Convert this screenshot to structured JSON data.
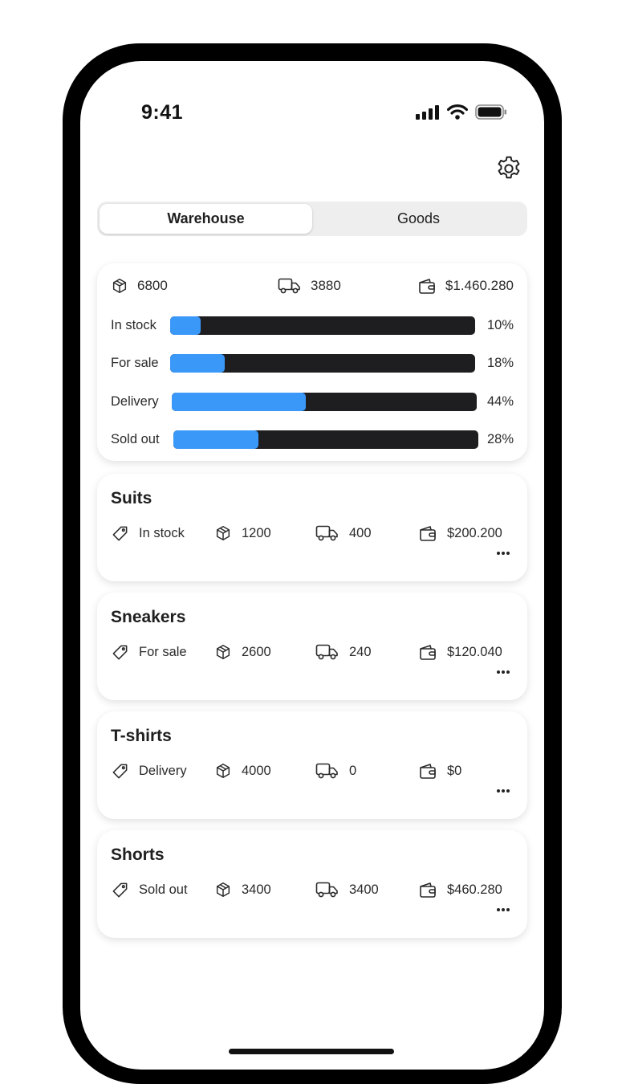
{
  "status": {
    "time": "9:41"
  },
  "tabs": [
    {
      "label": "Warehouse",
      "active": true
    },
    {
      "label": "Goods",
      "active": false
    }
  ],
  "summary": {
    "total_items": "6800",
    "in_delivery": "3880",
    "total_value": "$1.460.280",
    "bars": [
      {
        "label": "In stock",
        "percent_text": "10%",
        "value": 10
      },
      {
        "label": "For sale",
        "percent_text": "18%",
        "value": 18
      },
      {
        "label": "Delivery",
        "percent_text": "44%",
        "value": 44
      },
      {
        "label": "Sold out",
        "percent_text": "28%",
        "value": 28
      }
    ]
  },
  "goods": [
    {
      "title": "Suits",
      "status": "In stock",
      "items": "1200",
      "delivery": "400",
      "value": "$200.200"
    },
    {
      "title": "Sneakers",
      "status": "For sale",
      "items": "2600",
      "delivery": "240",
      "value": "$120.040"
    },
    {
      "title": "T-shirts",
      "status": "Delivery",
      "items": "4000",
      "delivery": "0",
      "value": "$0"
    },
    {
      "title": "Shorts",
      "status": "Sold out",
      "items": "3400",
      "delivery": "3400",
      "value": "$460.280"
    }
  ],
  "colors": {
    "accent": "#3a98f8",
    "track": "#1e1e20",
    "frame": "#000000"
  },
  "icons": [
    "signal-icon",
    "wifi-icon",
    "battery-icon",
    "gear-icon",
    "box-icon",
    "truck-icon",
    "wallet-icon",
    "tag-icon",
    "more-icon"
  ]
}
